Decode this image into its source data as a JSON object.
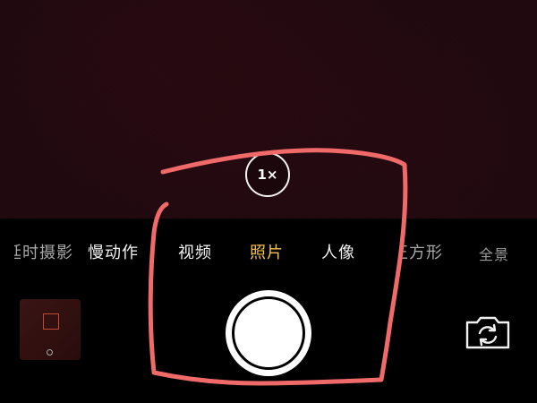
{
  "zoom": {
    "label": "1×"
  },
  "modes": {
    "items": [
      {
        "label": "延时摄影",
        "state": "clipped"
      },
      {
        "label": "慢动作",
        "state": "normal"
      },
      {
        "label": "视频",
        "state": "normal"
      },
      {
        "label": "照片",
        "state": "active"
      },
      {
        "label": "人像",
        "state": "normal"
      },
      {
        "label": "正方形",
        "state": "clipped"
      },
      {
        "label": "全景",
        "state": "faded"
      }
    ]
  },
  "colors": {
    "active_mode": "#f5c444",
    "annotation": "#f06a6a",
    "viewfinder": "#1c0a0f"
  },
  "icons": {
    "flip": "camera-flip-icon",
    "shutter": "shutter-button",
    "thumbnail": "last-photo-thumbnail"
  }
}
